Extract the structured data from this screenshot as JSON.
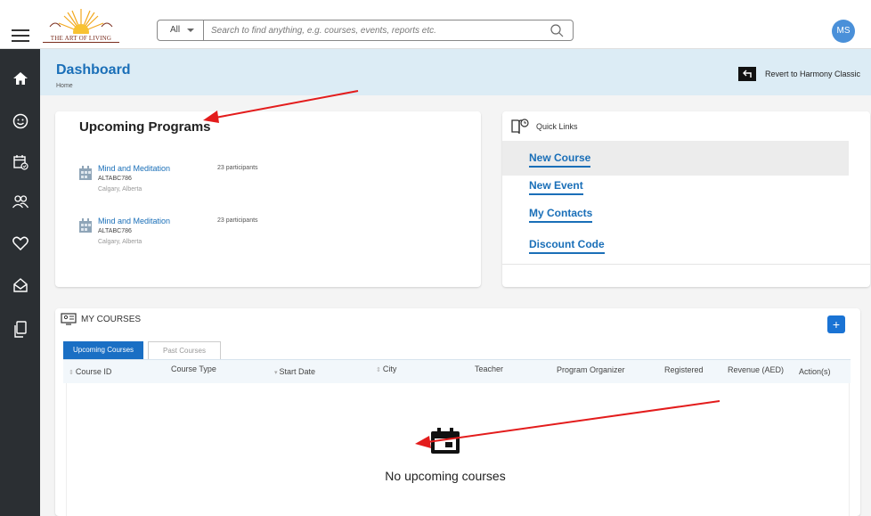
{
  "header": {
    "logo_text": "THE ART OF LIVING",
    "search_scope": "All",
    "search_placeholder": "Search to find anything, e.g. courses, events, reports etc.",
    "avatar_initials": "MS"
  },
  "page": {
    "title": "Dashboard",
    "breadcrumb": "Home",
    "revert_label": "Revert to Harmony Classic"
  },
  "sidebar": {
    "items": [
      {
        "icon": "home-icon"
      },
      {
        "icon": "smiley-icon"
      },
      {
        "icon": "calendar-check-icon"
      },
      {
        "icon": "people-icon"
      },
      {
        "icon": "heart-icon"
      },
      {
        "icon": "envelope-open-icon"
      },
      {
        "icon": "documents-icon"
      }
    ]
  },
  "upcoming": {
    "title": "Upcoming Programs",
    "programs": [
      {
        "name": "Mind and Meditation",
        "code": "ALTABC786",
        "location": "Calgary, Alberta",
        "participants": "23 participants"
      },
      {
        "name": "Mind and Meditation",
        "code": "ALTABC786",
        "location": "Calgary, Alberta",
        "participants": "23 participants"
      }
    ]
  },
  "quick_links": {
    "title": "Quick Links",
    "links": [
      "New Course",
      "New Event",
      "My Contacts",
      "Discount Code"
    ]
  },
  "my_courses": {
    "title": "MY COURSES",
    "add_label": "+",
    "tabs": [
      "Upcoming Courses",
      "Past Courses"
    ],
    "columns": [
      "Course  ID",
      "Course Type",
      "Start  Date",
      "City",
      "Teacher",
      "Program Organizer",
      "Registered",
      "Revenue (AED)",
      "Action(s)"
    ],
    "empty_message": "No upcoming courses"
  },
  "colors": {
    "accent": "#1a6fb8",
    "sidebar_bg": "#2b2f33",
    "header_bg": "#dcecf5",
    "annotation": "#e31c1c"
  }
}
